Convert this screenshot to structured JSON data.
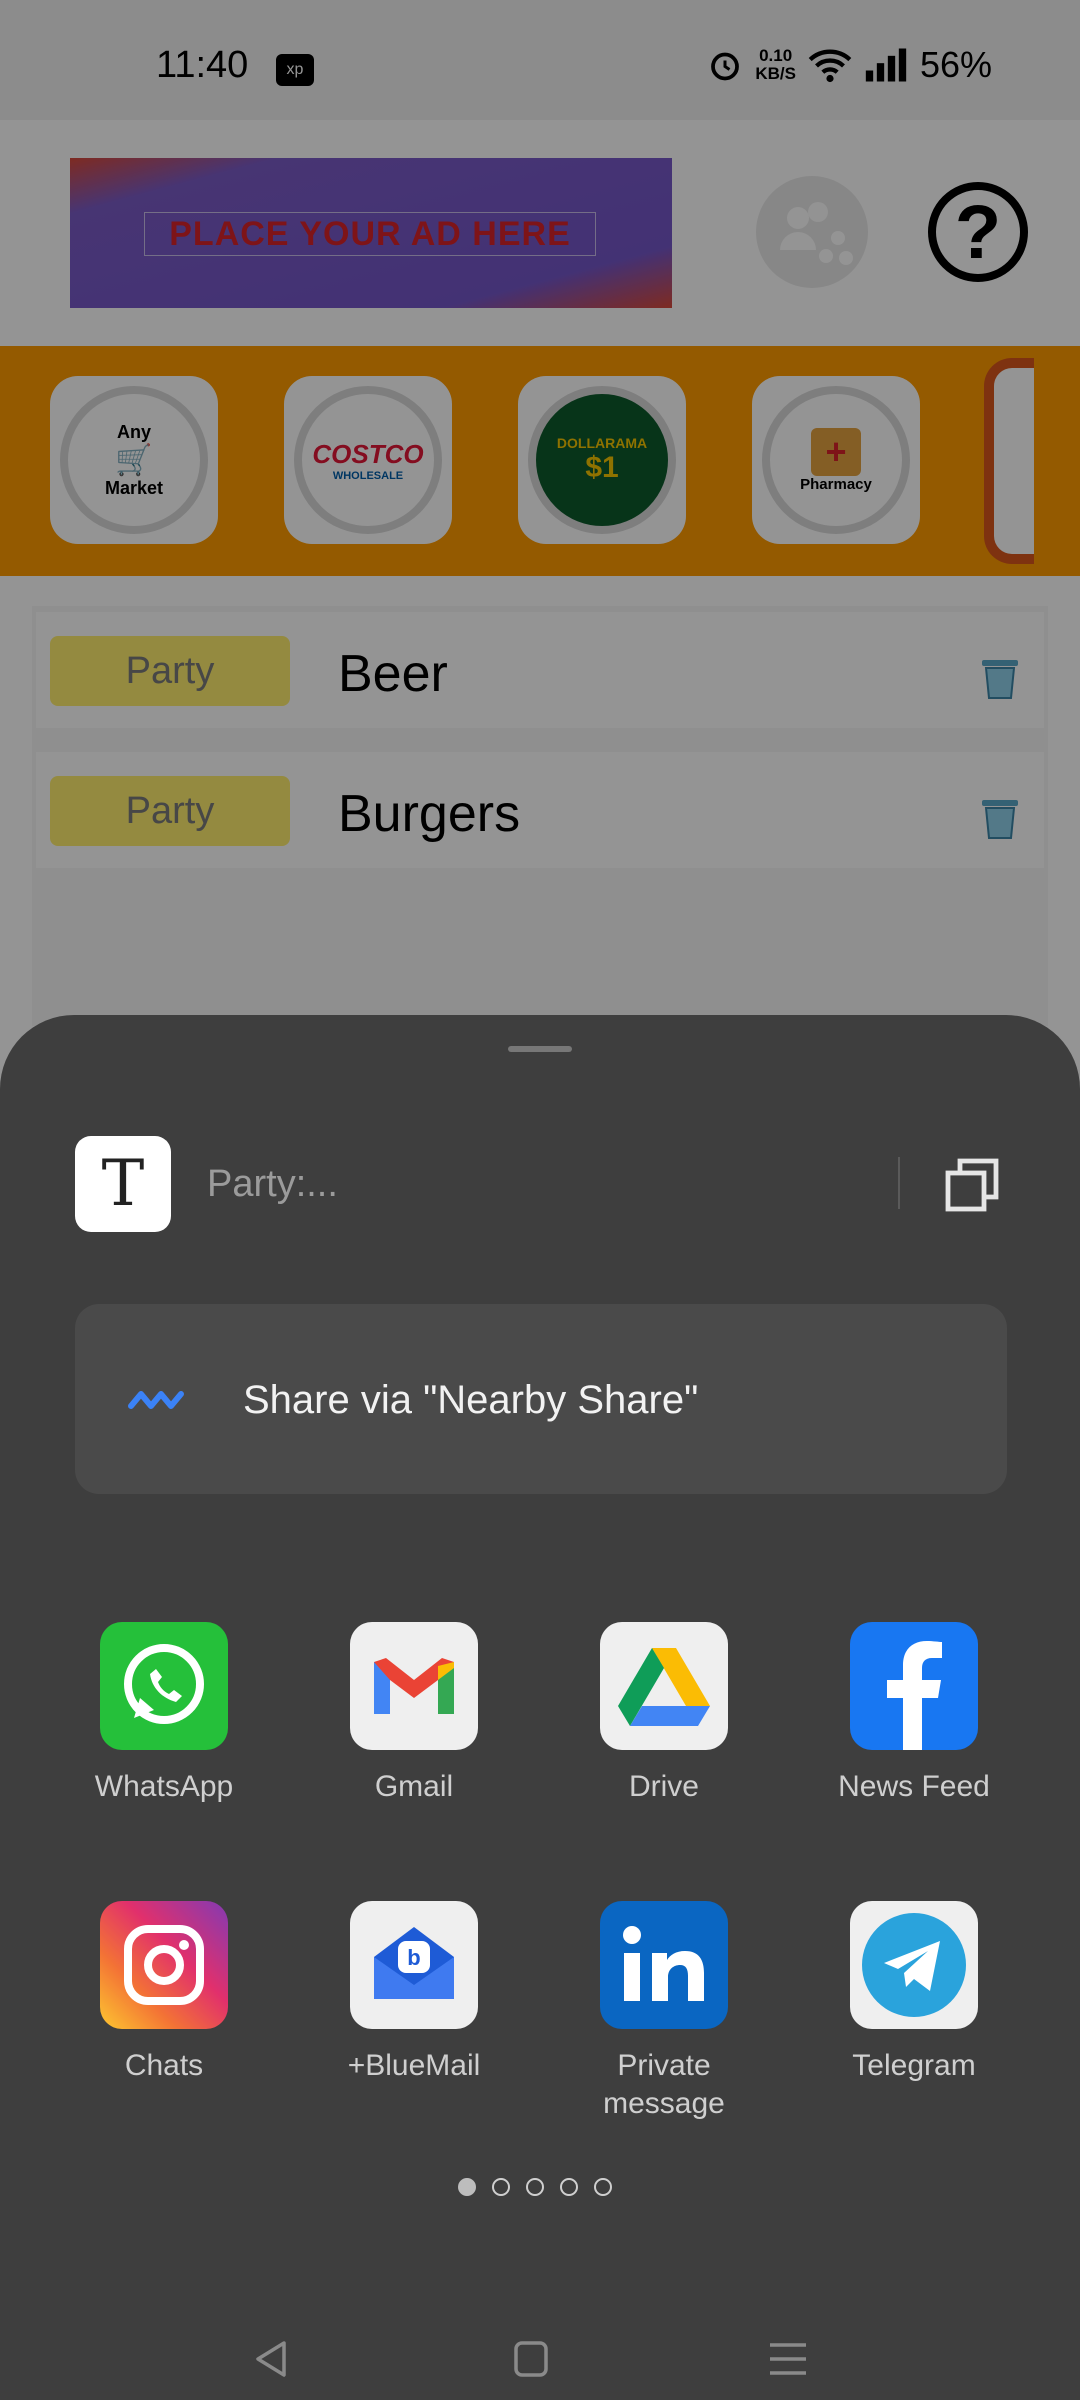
{
  "status_bar": {
    "time": "11:40",
    "speed_value": "0.10",
    "speed_unit": "KB/S",
    "battery": "56%"
  },
  "app": {
    "ad_text": "PLACE YOUR AD HERE",
    "stores": [
      {
        "name": "Any Market",
        "line1": "Any",
        "line2": "Market"
      },
      {
        "name": "Costco",
        "label": "COSTCO",
        "sub": "WHOLESALE"
      },
      {
        "name": "Dollarama",
        "label": "DOLLARAMA"
      },
      {
        "name": "Pharmacy",
        "label": "Pharmacy"
      }
    ],
    "items": [
      {
        "tag": "Party",
        "name": "Beer"
      },
      {
        "tag": "Party",
        "name": "Burgers"
      }
    ]
  },
  "share_sheet": {
    "preview_text": "Party:...",
    "nearby_label": "Share via \"Nearby Share\"",
    "apps": [
      {
        "label": "WhatsApp",
        "icon": "whatsapp-icon"
      },
      {
        "label": "Gmail",
        "icon": "gmail-icon"
      },
      {
        "label": "Drive",
        "icon": "drive-icon"
      },
      {
        "label": "News Feed",
        "icon": "facebook-icon"
      },
      {
        "label": "Chats",
        "icon": "instagram-icon"
      },
      {
        "label": "+BlueMail",
        "icon": "bluemail-icon"
      },
      {
        "label": "Private message",
        "icon": "linkedin-icon"
      },
      {
        "label": "Telegram",
        "icon": "telegram-icon"
      }
    ],
    "page_count": 5,
    "active_page": 1
  },
  "colors": {
    "accent_orange": "#ff9b00",
    "sheet_bg": "#3e3e3e",
    "tag_yellow": "#ffee6e"
  }
}
